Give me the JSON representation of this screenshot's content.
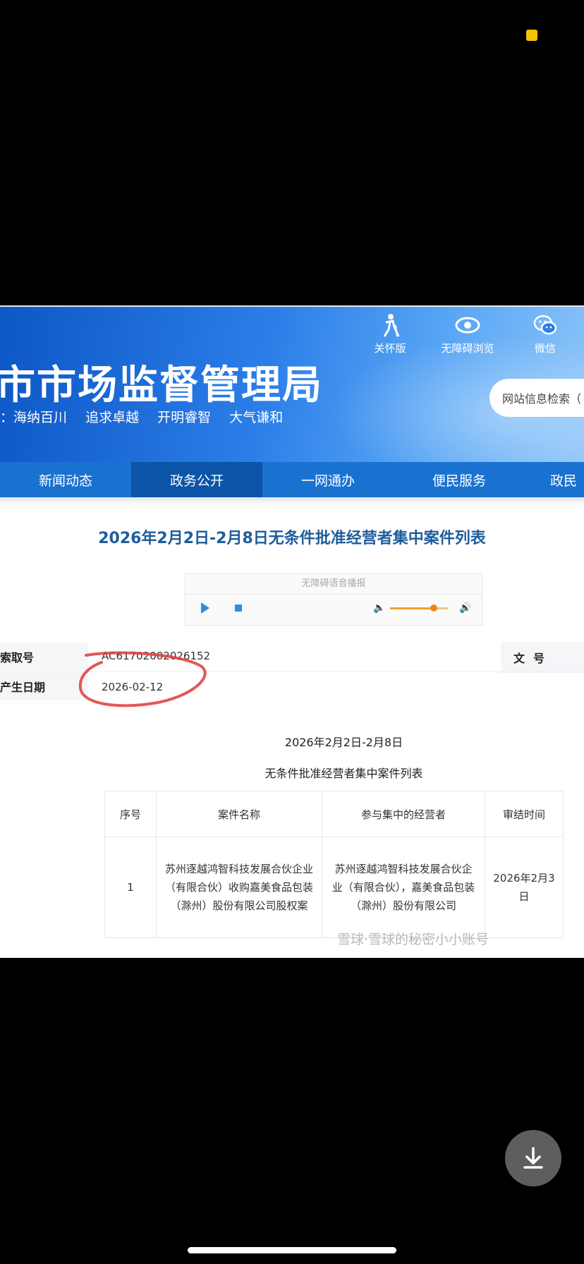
{
  "header": {
    "title": "市市场监督管理局",
    "slogan": [
      "：海纳百川",
      "追求卓越",
      "开明睿智",
      "大气谦和"
    ],
    "tools": [
      {
        "label": "关怀版",
        "icon": "elderly-care-icon"
      },
      {
        "label": "无障碍浏览",
        "icon": "eye-icon"
      },
      {
        "label": "微信",
        "icon": "wechat-icon"
      }
    ],
    "search_placeholder": "网站信息检索（"
  },
  "nav": {
    "items": [
      "新闻动态",
      "政务公开",
      "一网通办",
      "便民服务",
      "政民"
    ],
    "active_index": 1
  },
  "page_title": "2026年2月2日-2月8日无条件批准经营者集中案件列表",
  "audio": {
    "label": "无障碍语音播报",
    "volume": 0.75
  },
  "meta": {
    "index_label": "索取号",
    "index_value": "AC61702002026152",
    "date_label": "产生日期",
    "date_value": "2026-02-12",
    "doc_no_label": "文号"
  },
  "document": {
    "date_range": "2026年2月2日-2月8日",
    "subtitle": "无条件批准经营者集中案件列表",
    "columns": [
      "序号",
      "案件名称",
      "参与集中的经营者",
      "审结时间"
    ],
    "rows": [
      {
        "no": "1",
        "case": "苏州逐越鸿智科技发展合伙企业（有限合伙）收购嘉美食品包装（滁州）股份有限公司股权案",
        "parties": "苏州逐越鸿智科技发展合伙企业（有限合伙），嘉美食品包装（滁州）股份有限公司",
        "date": "2026年2月3日"
      }
    ]
  },
  "watermark": "雪球·雪球的秘密小小账号",
  "colors": {
    "banner": "#1a6fd8",
    "nav": "#1a72d0",
    "nav_active": "#0b54a8",
    "title_text": "#1f5c9d",
    "annotation": "#e03a3a"
  }
}
